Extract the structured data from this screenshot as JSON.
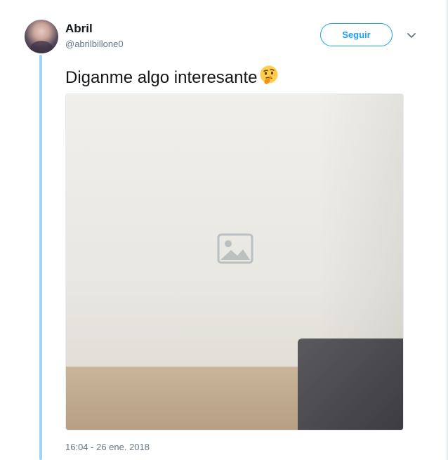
{
  "author": {
    "name": "Abril",
    "handle": "@abrilbillone0"
  },
  "follow_button": {
    "label": "Seguir"
  },
  "tweet": {
    "text": "Diganme algo interesante",
    "emoji": "thinking-face-emoji",
    "media_icon": "image-icon",
    "timestamp": "16:04 - 26 ene. 2018"
  },
  "icons": {
    "menu": "chevron-down-icon"
  },
  "colors": {
    "accent": "#1da1f2",
    "thread_line": "#9fd3f7",
    "muted_text": "#657786",
    "primary_text": "#14171a"
  }
}
